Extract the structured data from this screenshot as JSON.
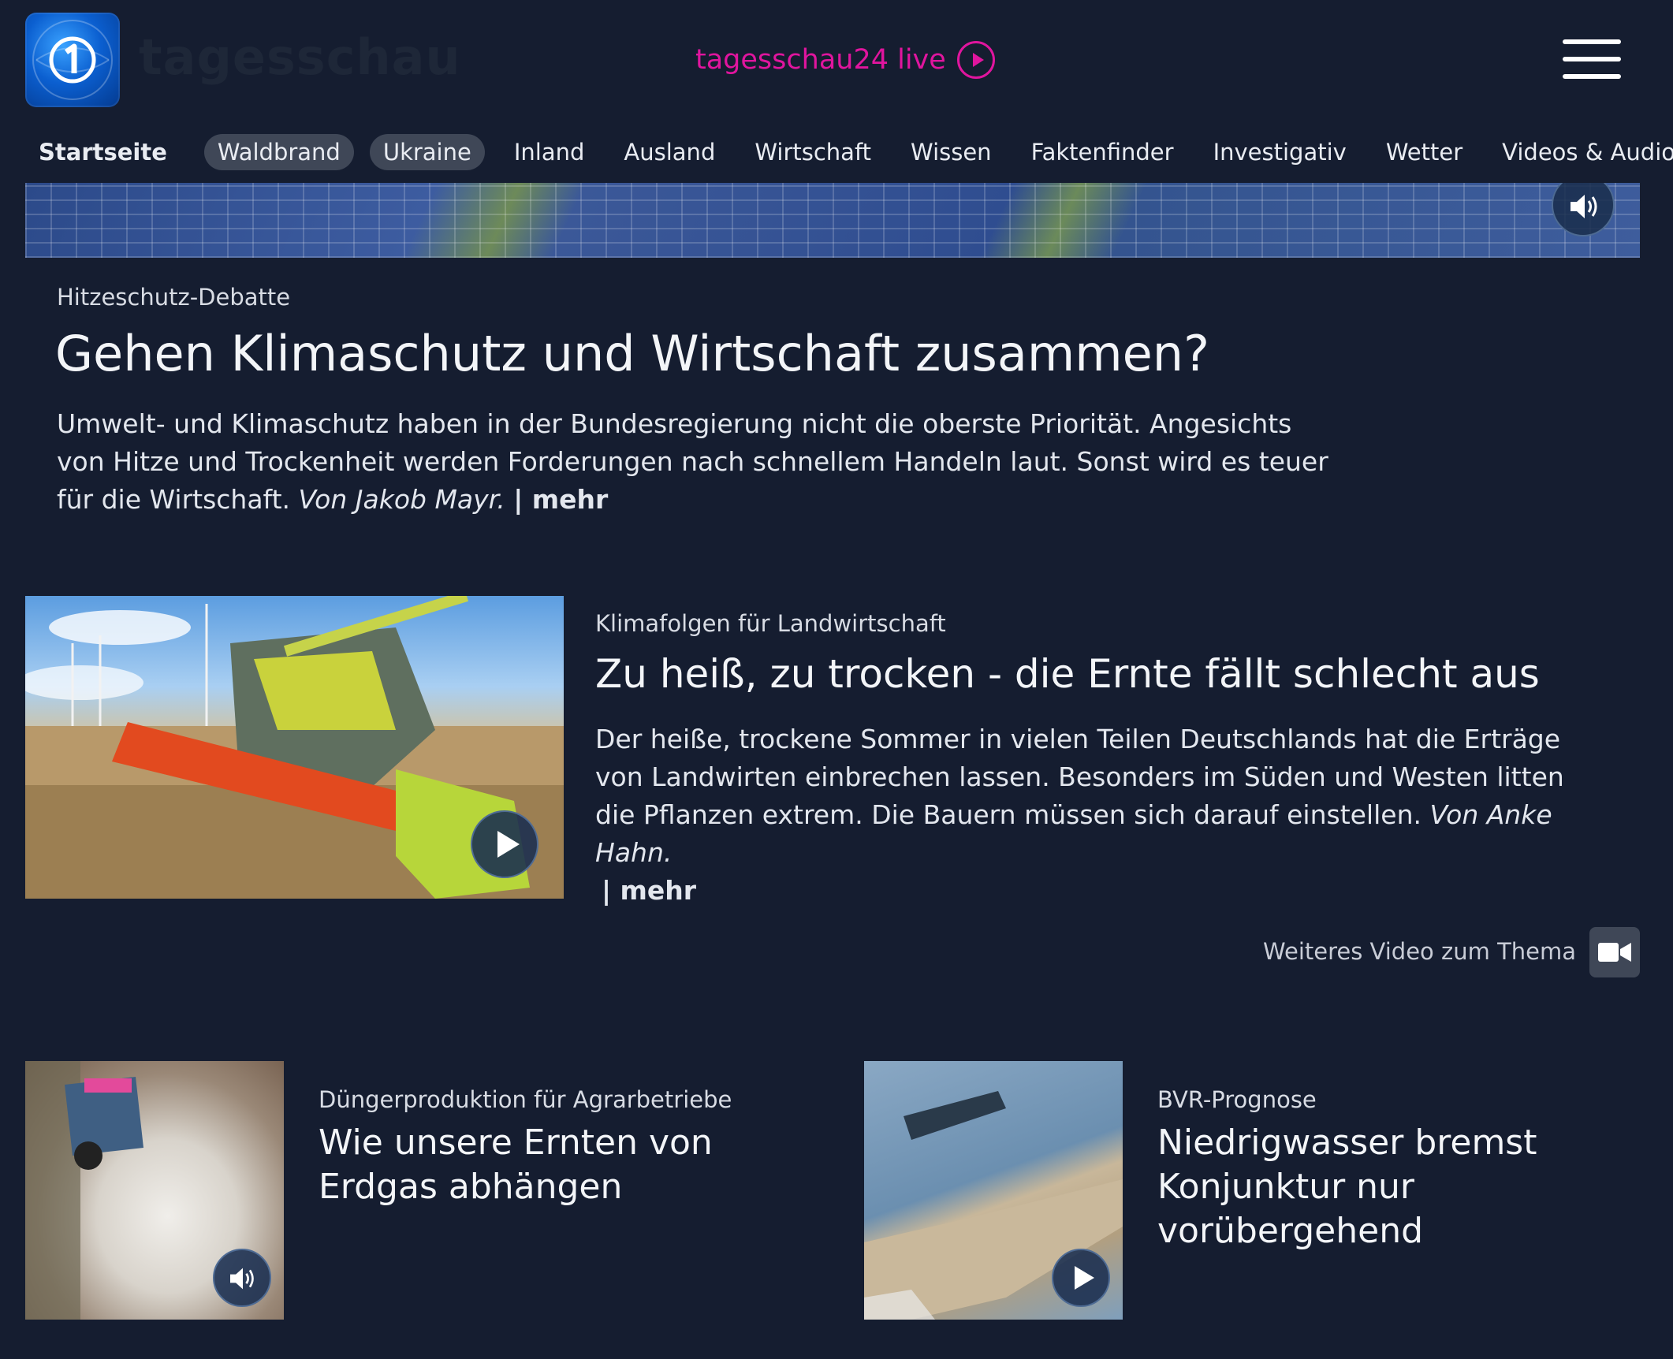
{
  "header": {
    "brand": "tagesschau",
    "live_label": "tagesschau24 live"
  },
  "nav": {
    "items": [
      {
        "label": "Startseite"
      },
      {
        "label": "Waldbrand"
      },
      {
        "label": "Ukraine"
      },
      {
        "label": "Inland"
      },
      {
        "label": "Ausland"
      },
      {
        "label": "Wirtschaft"
      },
      {
        "label": "Wissen"
      },
      {
        "label": "Faktenfinder"
      },
      {
        "label": "Investigativ"
      },
      {
        "label": "Wetter"
      },
      {
        "label": "Videos & Audios"
      }
    ]
  },
  "hero": {
    "kicker": "Hitzeschutz-Debatte",
    "title": "Gehen Klimaschutz und Wirtschaft zusammen?",
    "teaser": "Umwelt- und Klimaschutz haben in der Bundesregierung nicht die oberste Priorität. Angesichts von Hitze und Trockenheit werden Forderungen nach schnellem Handeln laut. Sonst wird es teuer für die Wirtschaft.",
    "author": "Von Jakob Mayr.",
    "more": "| mehr"
  },
  "article2": {
    "kicker": "Klimafolgen für Landwirtschaft",
    "title": "Zu heiß, zu trocken - die Ernte fällt schlecht aus",
    "teaser": "Der heiße, trockene Sommer in vielen Teilen Deutschlands hat die Erträge von Landwirten einbrechen lassen. Besonders im Süden und Westen litten die Pflanzen extrem. Die Bauern müssen sich darauf einstellen.",
    "author": "Von Anke Hahn.",
    "more": "| mehr",
    "more_video": "Weiteres Video zum Thema"
  },
  "article3": {
    "kicker": "Düngerproduktion für Agrarbetriebe",
    "title": "Wie unsere Ernten von Erdgas abhängen"
  },
  "article4": {
    "kicker": "BVR-Prognose",
    "title": "Niedrigwasser bremst Konjunktur nur vorübergehend"
  },
  "colors": {
    "background": "#151d30",
    "live_accent": "#e0159e",
    "pill": "#3f4757"
  }
}
